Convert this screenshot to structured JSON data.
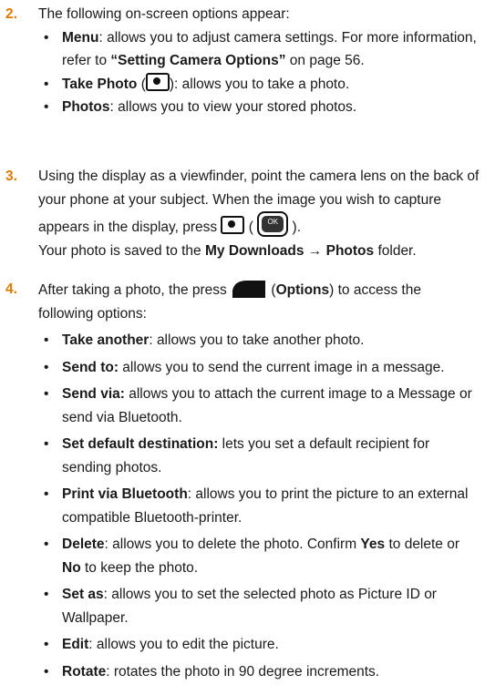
{
  "steps": [
    {
      "number": "2.",
      "intro": "The following on-screen options appear:",
      "bullets": [
        {
          "term": "Menu",
          "text1": ": allows you to adjust camera settings. For more information, refer to ",
          "ref": "“Setting Camera Options”",
          "text2": "  on page 56."
        },
        {
          "term": "Take Photo",
          "text1": " (",
          "text2": "): allows you to take a photo."
        },
        {
          "term": "Photos",
          "text1": ": allows you to view your stored photos."
        }
      ]
    },
    {
      "number": "3.",
      "line1": "Using the display as a viewfinder, point the camera lens on the back of your phone at your subject. When the image you wish to capture appears in the display, press ",
      "line1_end": " ( ",
      "line1_close": " ).",
      "ok_label": "OK",
      "saved_pre": "Your photo is saved to the ",
      "saved_folder": "My Downloads → Photos",
      "saved_post": " folder."
    },
    {
      "number": "4.",
      "intro_pre": "After taking a photo, the press ",
      "intro_term": "Options",
      "intro_post": ") to access the following options:",
      "intro_paren": " (",
      "bullets": [
        {
          "term": "Take another",
          "text": ": allows you to take another photo."
        },
        {
          "term": "Send to:",
          "text": " allows you to send the current image in a message."
        },
        {
          "term": "Send via:",
          "text": " allows you to attach the current image to a Message or send via Bluetooth."
        },
        {
          "term": "Set default destination:",
          "text": " lets you set a default recipient for sending photos."
        },
        {
          "term": "Print via Bluetooth",
          "text": ": allows you to print the picture to an external compatible Bluetooth-printer."
        },
        {
          "term": "Delete",
          "text": ": allows you to delete the photo. Confirm ",
          "term2": "Yes",
          "text2": " to delete or ",
          "term3": "No",
          "text3": " to keep the photo."
        },
        {
          "term": "Set as",
          "text": ": allows you to set the selected photo as Picture ID or Wallpaper."
        },
        {
          "term": "Edit",
          "text": ": allows you to edit the picture."
        },
        {
          "term": "Rotate",
          "text": ": rotates the photo in 90 degree increments."
        }
      ]
    }
  ],
  "bullet_glyph": "•"
}
